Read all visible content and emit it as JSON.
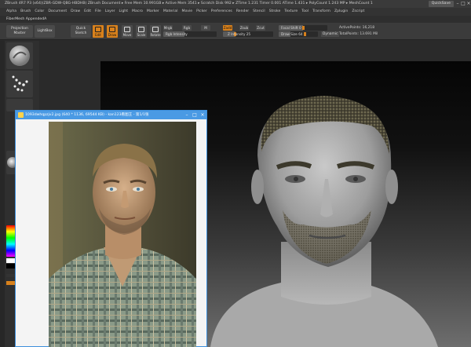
{
  "window": {
    "title": "ZBrush 4R7 P3 (x64)(ZBR-GDW-QBG-HBDHB)  ZBrush Document   ▸ Free Mem 10.991GB ▸ Active Mem 3541 ▸ Scratch Disk 992 ▸ ZTime 1.231 Timer 0.001 ATime 1.431 ▸ PolyCount 1.243 MP ▸ MeshCount 1",
    "quicksave_label": "QuickSave"
  },
  "menu": {
    "items": [
      "Alpha",
      "Brush",
      "Color",
      "Document",
      "Draw",
      "Edit",
      "File",
      "Layer",
      "Light",
      "Macro",
      "Marker",
      "Material",
      "Movie",
      "Picker",
      "Preferences",
      "Render",
      "Stencil",
      "Stroke",
      "Texture",
      "Tool",
      "Transform",
      "Zplugin",
      "Zscript"
    ]
  },
  "subbar": {
    "label": "FiberMesh  AppendedA"
  },
  "toolbar": {
    "projection_master": "Projection\nMaster",
    "lightbox": "LightBox",
    "quick_sketch": "Quick\nSketch",
    "edit": "Edit",
    "draw": "Draw",
    "move": "Move",
    "scale": "Scale",
    "rotate": "Rotate",
    "mrgb": "Mrgb",
    "rgb": "Rgb",
    "m": "M",
    "rgb_intensity": "Rgb Intensity",
    "zadd": "Zadd",
    "zsub": "Zsub",
    "zcut": "Zcut",
    "z_intensity": "Z Intensity 25",
    "focal_shift": "Focal Shift 0",
    "draw_size": "Draw Size 64",
    "dynamic": "Dynamic",
    "active_points": "ActivePoints: 16,218",
    "total_points": "TotalPoints: 13.691 Mil"
  },
  "viewer": {
    "title": "1093dwhqpzjv2.jpg (640 * 1136, 69544 KB) - kan123看图王 - 第1/1张"
  },
  "colors": {
    "accent": "#d8811c",
    "viewer_titlebar": "#4a9ae4"
  }
}
